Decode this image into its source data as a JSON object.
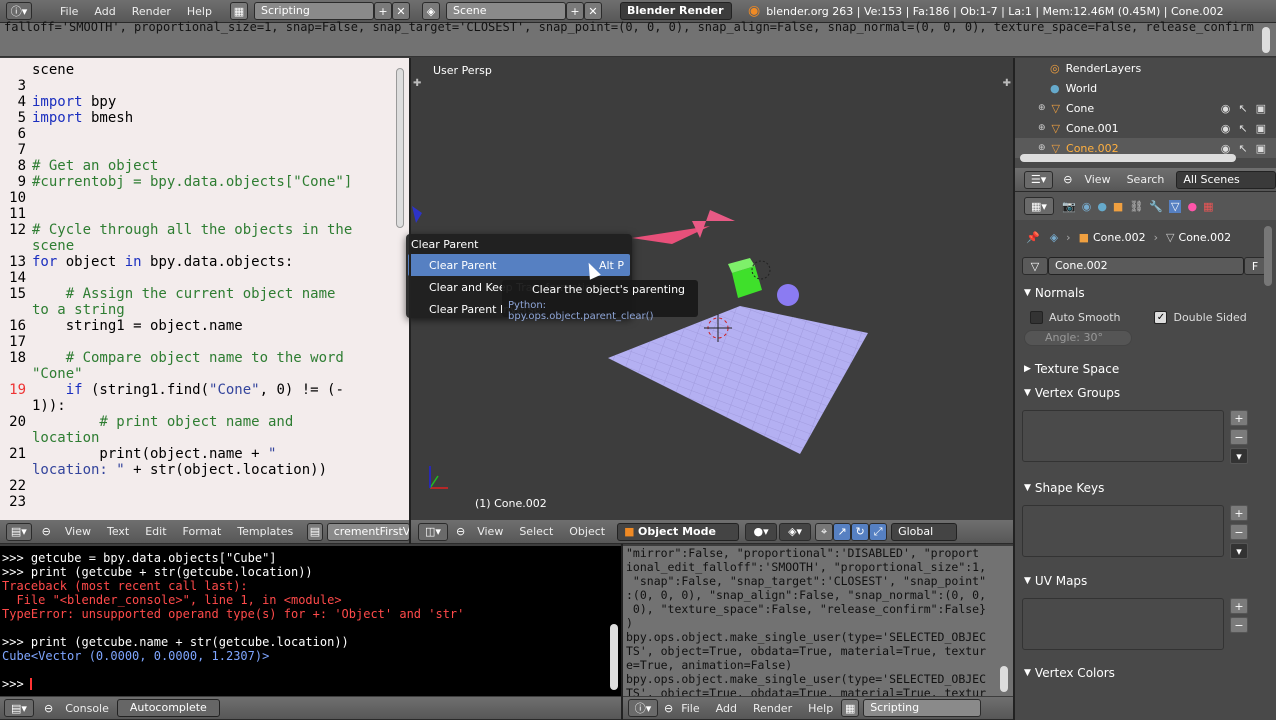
{
  "topbar": {
    "menus": [
      "File",
      "Add",
      "Render",
      "Help"
    ],
    "screen_layout": "Scripting",
    "scene": "Scene",
    "engine": "Blender Render",
    "stats": "blender.org 263 | Ve:153 | Fa:186 | Ob:1-7 | La:1 | Mem:12.46M (0.45M) | Cone.002",
    "info_log": "falloff='SMOOTH', proportional_size=1, snap=False, snap_target='CLOSEST', snap_point=(0, 0, 0), snap_align=False, snap_normal=(0, 0, 0), texture_space=False, release_confirm=True)"
  },
  "editor": {
    "lines": [
      {
        "n": "",
        "parts": [
          [
            "",
            "scene"
          ]
        ]
      },
      {
        "n": "3",
        "parts": [
          [
            "",
            ""
          ]
        ]
      },
      {
        "n": "4",
        "parts": [
          [
            "kw",
            "import"
          ],
          [
            "",
            " bpy"
          ]
        ]
      },
      {
        "n": "5",
        "parts": [
          [
            "kw",
            "import"
          ],
          [
            "",
            " bmesh"
          ]
        ]
      },
      {
        "n": "6",
        "parts": [
          [
            "",
            ""
          ]
        ]
      },
      {
        "n": "7",
        "parts": [
          [
            "",
            ""
          ]
        ]
      },
      {
        "n": "8",
        "parts": [
          [
            "cm",
            "# Get an object"
          ]
        ]
      },
      {
        "n": "9",
        "parts": [
          [
            "cm",
            "#currentobj = bpy.data.objects[\"Cone\"]"
          ]
        ]
      },
      {
        "n": "10",
        "parts": [
          [
            "",
            ""
          ]
        ]
      },
      {
        "n": "11",
        "parts": [
          [
            "",
            ""
          ]
        ]
      },
      {
        "n": "12",
        "parts": [
          [
            "cm",
            "# Cycle through all the objects in the"
          ]
        ]
      },
      {
        "n": "",
        "parts": [
          [
            "cm",
            "scene"
          ]
        ]
      },
      {
        "n": "13",
        "parts": [
          [
            "kw",
            "for"
          ],
          [
            "",
            " object "
          ],
          [
            "kw",
            "in"
          ],
          [
            "",
            " bpy.data.objects:"
          ]
        ]
      },
      {
        "n": "14",
        "parts": [
          [
            "",
            ""
          ]
        ]
      },
      {
        "n": "15",
        "parts": [
          [
            "cm",
            "    # Assign the current object name"
          ]
        ]
      },
      {
        "n": "",
        "parts": [
          [
            "cm",
            "to a string"
          ]
        ]
      },
      {
        "n": "16",
        "parts": [
          [
            "",
            "    string1 = object.name"
          ]
        ]
      },
      {
        "n": "17",
        "parts": [
          [
            "",
            ""
          ]
        ]
      },
      {
        "n": "18",
        "parts": [
          [
            "cm",
            "    # Compare object name to the word"
          ]
        ]
      },
      {
        "n": "",
        "parts": [
          [
            "cm",
            "\"Cone\""
          ]
        ]
      },
      {
        "n": "19",
        "parts": [
          [
            "",
            "    "
          ],
          [
            "kw",
            "if"
          ],
          [
            "",
            " (string1.find("
          ],
          [
            "st",
            "\"Cone\""
          ],
          [
            "",
            ", 0) != (-"
          ]
        ]
      },
      {
        "n": "",
        "parts": [
          [
            "",
            "1)):"
          ]
        ]
      },
      {
        "n": "20",
        "parts": [
          [
            "cm",
            "        # print object name and"
          ]
        ]
      },
      {
        "n": "",
        "parts": [
          [
            "cm",
            "location"
          ]
        ]
      },
      {
        "n": "21",
        "parts": [
          [
            "",
            "        print(object.name + "
          ],
          [
            "st",
            "\""
          ]
        ]
      },
      {
        "n": "",
        "parts": [
          [
            "st",
            "location: \""
          ],
          [
            "",
            " + str(object.location))"
          ]
        ]
      },
      {
        "n": "22",
        "parts": [
          [
            "",
            ""
          ]
        ]
      },
      {
        "n": "23",
        "parts": [
          [
            "",
            ""
          ]
        ]
      }
    ],
    "menus": [
      "View",
      "Text",
      "Edit",
      "Format",
      "Templates"
    ],
    "filename": "crementFirstVert"
  },
  "viewport": {
    "label": "User Persp",
    "object_label": "(1) Cone.002",
    "menus": [
      "View",
      "Select",
      "Object"
    ],
    "mode": "Object Mode",
    "orientation": "Global"
  },
  "context_menu": {
    "title": "Clear Parent",
    "items": [
      {
        "label": "Clear Parent",
        "shortcut": "Alt P"
      },
      {
        "label": "Clear and Keep Transformation",
        "shortcut": ""
      },
      {
        "label": "Clear Parent Inverse",
        "shortcut": ""
      }
    ],
    "tooltip_title": "Clear the object's parenting",
    "tooltip_python": "Python: bpy.ops.object.parent_clear()"
  },
  "outliner": {
    "items": [
      "RenderLayers",
      "World",
      "Cone",
      "Cone.001",
      "Cone.002"
    ],
    "menus": [
      "View",
      "Search"
    ],
    "filter": "All Scenes"
  },
  "properties": {
    "breadcrumb_obj": "Cone.002",
    "breadcrumb_mesh": "Cone.002",
    "mesh_name": "Cone.002",
    "fake_user": "F",
    "panels": {
      "normals": "Normals",
      "auto_smooth": "Auto Smooth",
      "double_sided": "Double Sided",
      "angle": "Angle: 30°",
      "texture_space": "Texture Space",
      "vertex_groups": "Vertex Groups",
      "shape_keys": "Shape Keys",
      "uv_maps": "UV Maps",
      "vertex_colors": "Vertex Colors"
    }
  },
  "console": {
    "lines": [
      {
        "c": "#ffffff",
        "t": ">>> getcube = bpy.data.objects[\"Cube\"]"
      },
      {
        "c": "#ffffff",
        "t": ">>> print (getcube + str(getcube.location))"
      },
      {
        "c": "#ff4a4a",
        "t": "Traceback (most recent call last):"
      },
      {
        "c": "#ff4a4a",
        "t": "  File \"<blender_console>\", line 1, in <module>"
      },
      {
        "c": "#ff4a4a",
        "t": "TypeError: unsupported operand type(s) for +: 'Object' and 'str'"
      },
      {
        "c": "#ffffff",
        "t": ""
      },
      {
        "c": "#ffffff",
        "t": ">>> print (getcube.name + str(getcube.location))"
      },
      {
        "c": "#7fa6ff",
        "t": "Cube<Vector (0.0000, 0.0000, 1.2307)>"
      },
      {
        "c": "#ffffff",
        "t": ""
      },
      {
        "c": "#ffffff",
        "t": ">>> "
      }
    ],
    "tabs": [
      "Console",
      "Autocomplete"
    ]
  },
  "info_report": {
    "lines": [
      "\"mirror\":False, \"proportional\":'DISABLED', \"proport",
      "ional_edit_falloff\":'SMOOTH', \"proportional_size\":1,",
      " \"snap\":False, \"snap_target\":'CLOSEST', \"snap_point\"",
      ":(0, 0, 0), \"snap_align\":False, \"snap_normal\":(0, 0,",
      " 0), \"texture_space\":False, \"release_confirm\":False}",
      ")",
      "bpy.ops.object.make_single_user(type='SELECTED_OBJEC",
      "TS', object=True, obdata=True, material=True, textur",
      "e=True, animation=False)",
      "bpy.ops.object.make_single_user(type='SELECTED_OBJEC",
      "TS', object=True, obdata=True, material=True, textur"
    ],
    "menus": [
      "File",
      "Add",
      "Render",
      "Help"
    ],
    "layout": "Scripting"
  }
}
